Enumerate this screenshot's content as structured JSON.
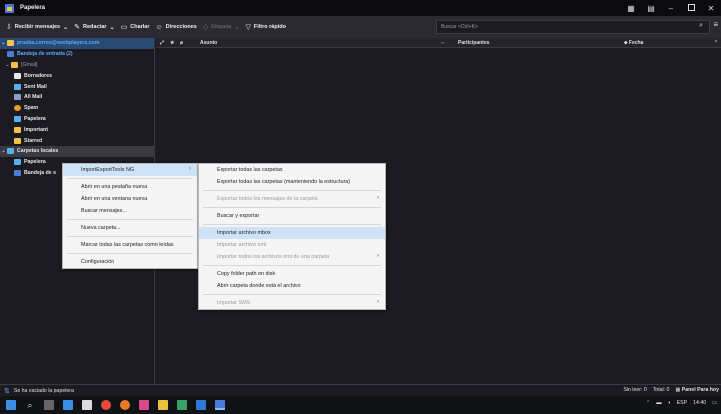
{
  "window": {
    "title": "Papelera"
  },
  "toolbar": {
    "get_messages": "Recibir mensajes",
    "write": "Redactar",
    "chat": "Charlar",
    "address_book": "Direcciones",
    "tag": "Etiqueta",
    "quick_filter": "Filtro rápido",
    "search_placeholder": "Buscar <Ctrl+K>"
  },
  "folders": [
    {
      "label": "prueba.correo@workplayers.com",
      "kind": "account"
    },
    {
      "label": "Bandeja de entrada (2)",
      "kind": "inbox"
    },
    {
      "label": "[Gmail]",
      "kind": "gmail"
    },
    {
      "label": "Borradores",
      "kind": "sub"
    },
    {
      "label": "Sent Mail",
      "kind": "sub"
    },
    {
      "label": "All Mail",
      "kind": "sub"
    },
    {
      "label": "Spam",
      "kind": "sub"
    },
    {
      "label": "Papelera",
      "kind": "sub"
    },
    {
      "label": "Important",
      "kind": "sub"
    },
    {
      "label": "Starred",
      "kind": "sub"
    },
    {
      "label": "Carpetas locales",
      "kind": "locals"
    },
    {
      "label": "Papelera",
      "kind": "sub2"
    },
    {
      "label": "Bandeja de s",
      "kind": "sub2"
    }
  ],
  "thread_header": {
    "subject": "Asunto",
    "participants": "Participantes",
    "date": "Fecha"
  },
  "context_menu": [
    {
      "label": "ImportExportTools NG",
      "submenu": true,
      "highlighted": true
    },
    {
      "sep": true
    },
    {
      "label": "Abrir en una pestaña nueva"
    },
    {
      "label": "Abrir en una ventana nueva"
    },
    {
      "label": "Buscar mensajes..."
    },
    {
      "sep": true
    },
    {
      "label": "Nueva carpeta..."
    },
    {
      "sep": true
    },
    {
      "label": "Marcar todas las carpetas como leídas"
    },
    {
      "sep": true
    },
    {
      "label": "Configuración"
    }
  ],
  "submenu": [
    {
      "label": "Exportar todas las carpetas"
    },
    {
      "label": "Exportar todas las carpetas (manteniendo la estructura)"
    },
    {
      "sep": true
    },
    {
      "label": "Exportar todos los mensajes de la carpeta",
      "disabled": true,
      "submenu": true
    },
    {
      "sep": true
    },
    {
      "label": "Buscar y exportar"
    },
    {
      "sep": true
    },
    {
      "label": "Importar archivo mbox",
      "highlighted": true
    },
    {
      "label": "Importar archivo eml",
      "disabled": true
    },
    {
      "label": "Importar todos los archivos eml de una carpeta",
      "disabled": true,
      "submenu": true
    },
    {
      "sep": true
    },
    {
      "label": "Copy folder path on disk"
    },
    {
      "label": "Abrir carpeta donde está el archivo"
    },
    {
      "sep": true
    },
    {
      "label": "Importar SMS",
      "disabled": true,
      "submenu": true
    }
  ],
  "status": {
    "message": "Se ha vaciado la papelera",
    "unread": "Sin leer: 0",
    "total": "Total: 0",
    "today_pane": "Panel Para hoy"
  },
  "tray": {
    "lang": "ESP",
    "time": "14:40"
  },
  "colors": {
    "accent": "#2a4a73",
    "link": "#59a9ff",
    "menu_highlight": "#cfe3f8"
  }
}
